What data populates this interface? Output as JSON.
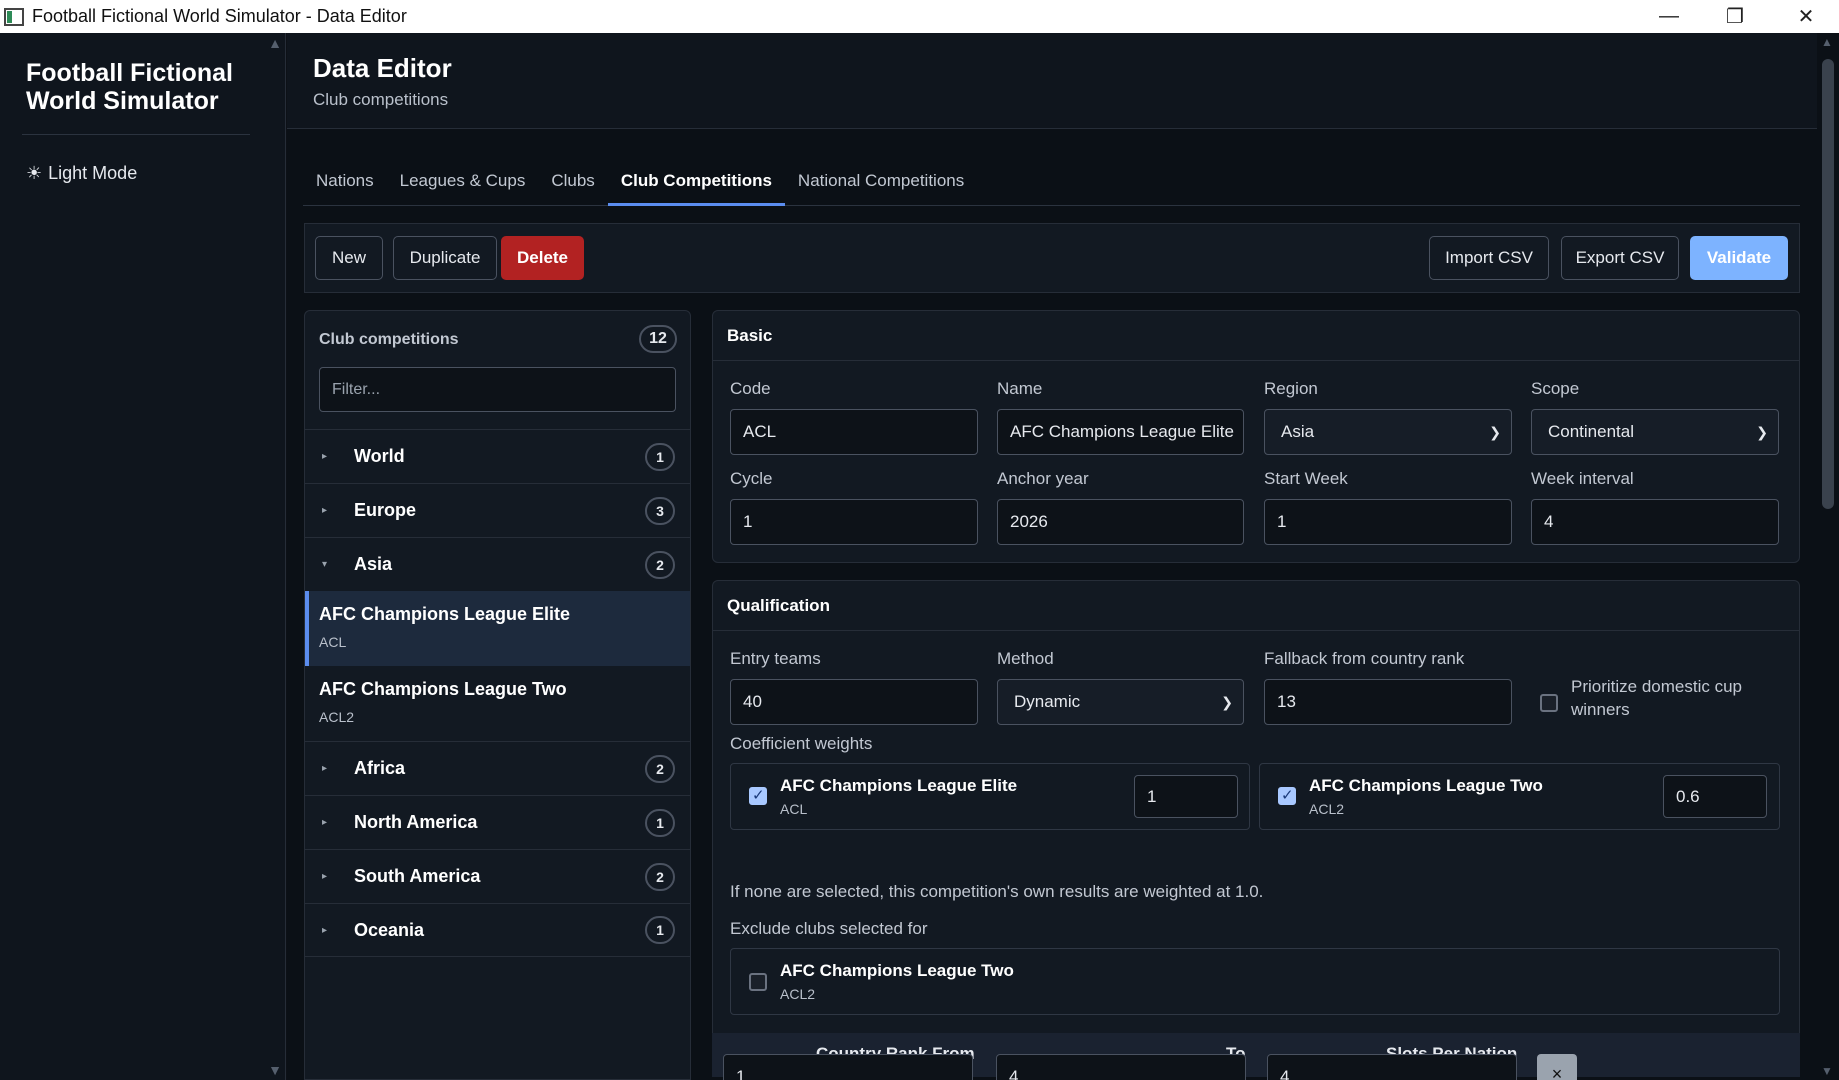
{
  "window": {
    "title": "Football Fictional World Simulator - Data Editor"
  },
  "sidebar": {
    "brand": "Football Fictional World Simulator",
    "mode_toggle": "Light Mode"
  },
  "header": {
    "title": "Data Editor",
    "subtitle": "Club competitions"
  },
  "tabs": [
    {
      "label": "Nations"
    },
    {
      "label": "Leagues & Cups"
    },
    {
      "label": "Clubs"
    },
    {
      "label": "Club Competitions",
      "active": true
    },
    {
      "label": "National Competitions"
    }
  ],
  "toolbar": {
    "new": "New",
    "duplicate": "Duplicate",
    "delete": "Delete",
    "import": "Import CSV",
    "export": "Export CSV",
    "validate": "Validate"
  },
  "list": {
    "heading": "Club competitions",
    "count": "12",
    "filter_placeholder": "Filter...",
    "groups": [
      {
        "name": "World",
        "count": "1",
        "expanded": false
      },
      {
        "name": "Europe",
        "count": "3",
        "expanded": false
      },
      {
        "name": "Asia",
        "count": "2",
        "expanded": true,
        "items": [
          {
            "name": "AFC Champions League Elite",
            "code": "ACL",
            "selected": true
          },
          {
            "name": "AFC Champions League Two",
            "code": "ACL2",
            "selected": false
          }
        ]
      },
      {
        "name": "Africa",
        "count": "2",
        "expanded": false
      },
      {
        "name": "North America",
        "count": "1",
        "expanded": false
      },
      {
        "name": "South America",
        "count": "2",
        "expanded": false
      },
      {
        "name": "Oceania",
        "count": "1",
        "expanded": false
      }
    ]
  },
  "basic": {
    "title": "Basic",
    "code_label": "Code",
    "code": "ACL",
    "name_label": "Name",
    "name": "AFC Champions League Elite",
    "region_label": "Region",
    "region": "Asia",
    "scope_label": "Scope",
    "scope": "Continental",
    "cycle_label": "Cycle",
    "cycle": "1",
    "anchor_label": "Anchor year",
    "anchor": "2026",
    "start_label": "Start Week",
    "start": "1",
    "interval_label": "Week interval",
    "interval": "4"
  },
  "qualification": {
    "title": "Qualification",
    "entry_label": "Entry teams",
    "entry": "40",
    "method_label": "Method",
    "method": "Dynamic",
    "fallback_label": "Fallback from country rank",
    "fallback": "13",
    "prioritize_label": "Prioritize domestic cup winners",
    "coef_label": "Coefficient weights",
    "weights": [
      {
        "name": "AFC Champions League Elite",
        "code": "ACL",
        "value": "1",
        "checked": true
      },
      {
        "name": "AFC Champions League Two",
        "code": "ACL2",
        "value": "0.6",
        "checked": true
      }
    ],
    "coef_note": "If none are selected, this competition's own results are weighted at 1.0.",
    "exclude_label": "Exclude clubs selected for",
    "exclude": {
      "name": "AFC Champions League Two",
      "code": "ACL2",
      "checked": false
    }
  },
  "slots": {
    "col_from": "Country Rank From",
    "col_to": "To",
    "col_slots": "Slots Per Nation",
    "row1": {
      "from": "1",
      "to": "4",
      "slots": "4",
      "remove": "×"
    }
  },
  "icons": {
    "sun": "sun-icon",
    "minimize": "minimize-icon",
    "restore": "restore-icon",
    "close": "close-icon",
    "caret": "caret-icon",
    "chevron": "chevron-down-icon"
  },
  "colors": {
    "accent": "#5b8def",
    "danger": "#b22222",
    "primary": "#7db3ff"
  }
}
